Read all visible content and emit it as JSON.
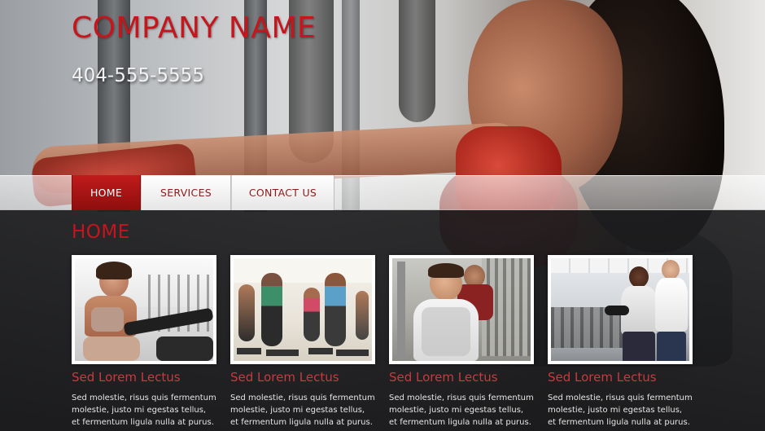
{
  "header": {
    "company_name": "COMPANY NAME",
    "phone": "404-555-5555"
  },
  "nav": {
    "items": [
      {
        "label": "HOME",
        "active": true
      },
      {
        "label": "SERVICES",
        "active": false
      },
      {
        "label": "CONTACT US",
        "active": false
      }
    ]
  },
  "main": {
    "heading": "HOME",
    "cards": [
      {
        "title": "Sed Lorem Lectus",
        "text": "Sed molestie, risus quis fermentum molestie, justo mi egestas tellus, et fermentum ligula nulla at purus."
      },
      {
        "title": "Sed Lorem Lectus",
        "text": "Sed molestie, risus quis fermentum molestie, justo mi egestas tellus, et fermentum ligula nulla at purus."
      },
      {
        "title": "Sed Lorem Lectus",
        "text": "Sed molestie, risus quis fermentum molestie, justo mi egestas tellus, et fermentum ligula nulla at purus."
      },
      {
        "title": "Sed Lorem Lectus",
        "text": "Sed molestie, risus quis fermentum molestie, justo mi egestas tellus, et fermentum ligula nulla at purus."
      }
    ]
  },
  "colors": {
    "brand_red": "#c4161c",
    "nav_active": "#a81414",
    "card_title": "#c93a3e",
    "body_text": "#e6e6e6"
  }
}
